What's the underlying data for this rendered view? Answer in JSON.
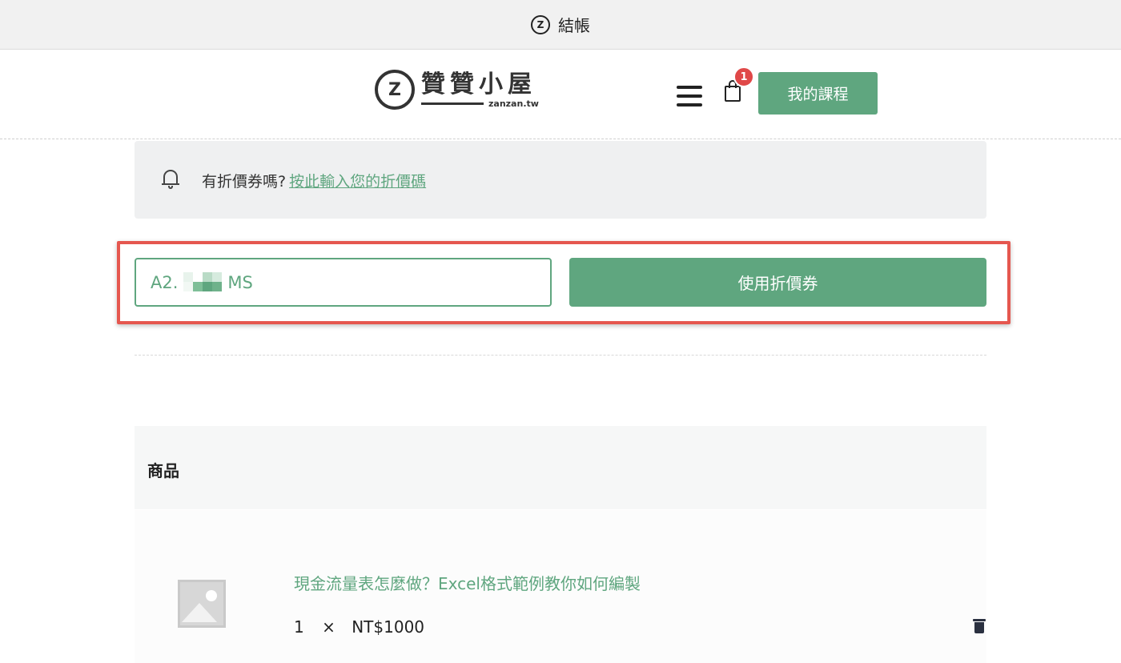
{
  "browser": {
    "tab_logo": "z-logo-icon",
    "tab_title": "結帳"
  },
  "header": {
    "brand_name": "贊贊小屋",
    "brand_domain": "zanzan.tw",
    "cart_count": "1",
    "courses_label": "我的課程"
  },
  "coupon_notice": {
    "text": "有折價券嗎?",
    "link": "按此輸入您的折價碼"
  },
  "coupon_form": {
    "value_prefix": "A2.",
    "value_suffix": "MS",
    "apply_label": "使用折價券"
  },
  "products": {
    "header": "商品",
    "items": [
      {
        "title": "現金流量表怎麼做？Excel格式範例教你如何編製",
        "qty": "1",
        "times": "×",
        "price": "NT$1000"
      }
    ]
  },
  "colors": {
    "accent": "#5fa67f",
    "highlight": "#e5574f",
    "badge": "#e04848"
  }
}
